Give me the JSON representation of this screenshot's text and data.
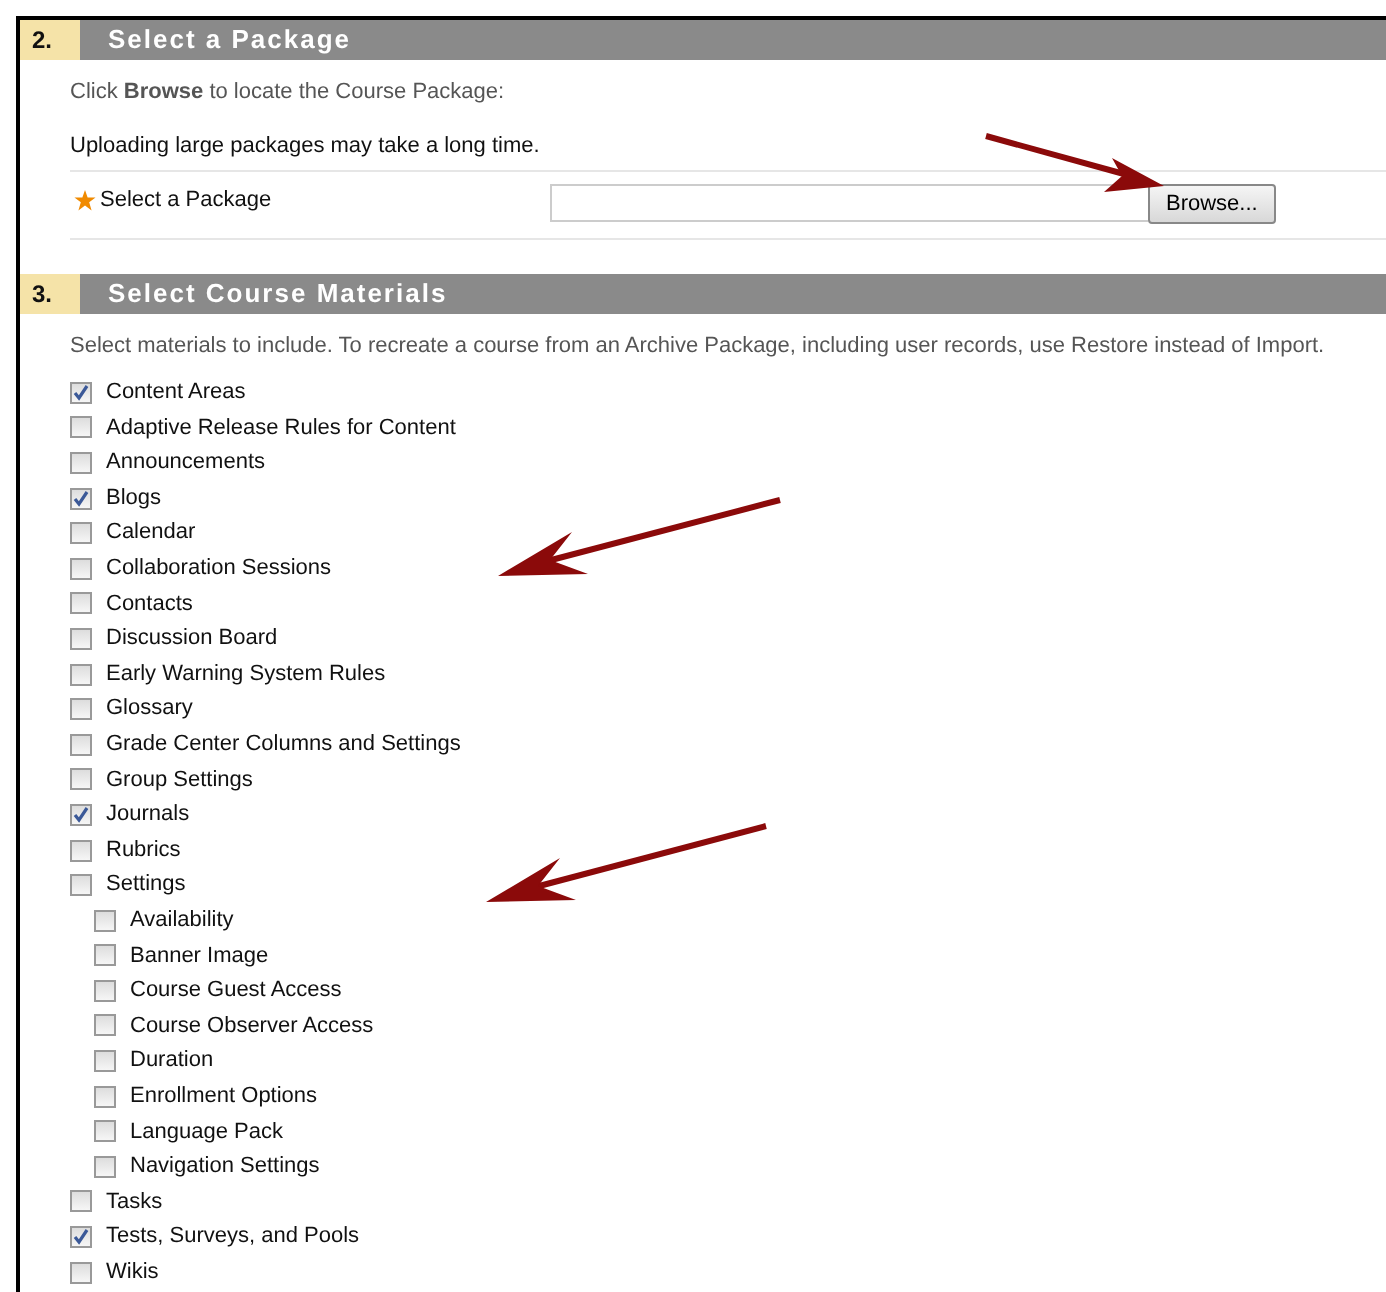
{
  "sections": [
    {
      "number": "2.",
      "title": "Select a Package",
      "instruction": "Click **Browse** to locate the Course Package:",
      "note": "Uploading large packages may take a long time.",
      "field": {
        "label": "Select a Package",
        "required": true,
        "button": "Browse..."
      }
    },
    {
      "number": "3.",
      "title": "Select Course Materials",
      "instruction": "Select materials to include. To recreate a course from an Archive Package, including user records, use Restore instead of Import.",
      "items": [
        {
          "label": "Content Areas",
          "checked": true
        },
        {
          "label": "Adaptive Release Rules for Content",
          "checked": false
        },
        {
          "label": "Announcements",
          "checked": false
        },
        {
          "label": "Blogs",
          "checked": true
        },
        {
          "label": "Calendar",
          "checked": false
        },
        {
          "label": "Collaboration Sessions",
          "checked": false
        },
        {
          "label": "Contacts",
          "checked": false
        },
        {
          "label": "Discussion Board",
          "checked": false
        },
        {
          "label": "Early Warning System Rules",
          "checked": false
        },
        {
          "label": "Glossary",
          "checked": false
        },
        {
          "label": "Grade Center Columns and Settings",
          "checked": false
        },
        {
          "label": "Group Settings",
          "checked": false
        },
        {
          "label": "Journals",
          "checked": true
        },
        {
          "label": "Rubrics",
          "checked": false
        },
        {
          "label": "Settings",
          "checked": false,
          "children": [
            {
              "label": "Availability",
              "checked": false
            },
            {
              "label": "Banner Image",
              "checked": false
            },
            {
              "label": "Course Guest Access",
              "checked": false
            },
            {
              "label": "Course Observer Access",
              "checked": false
            },
            {
              "label": "Duration",
              "checked": false
            },
            {
              "label": "Enrollment Options",
              "checked": false
            },
            {
              "label": "Language Pack",
              "checked": false
            },
            {
              "label": "Navigation Settings",
              "checked": false
            }
          ]
        },
        {
          "label": "Tasks",
          "checked": false
        },
        {
          "label": "Tests, Surveys, and Pools",
          "checked": true
        },
        {
          "label": "Wikis",
          "checked": false
        }
      ]
    }
  ]
}
